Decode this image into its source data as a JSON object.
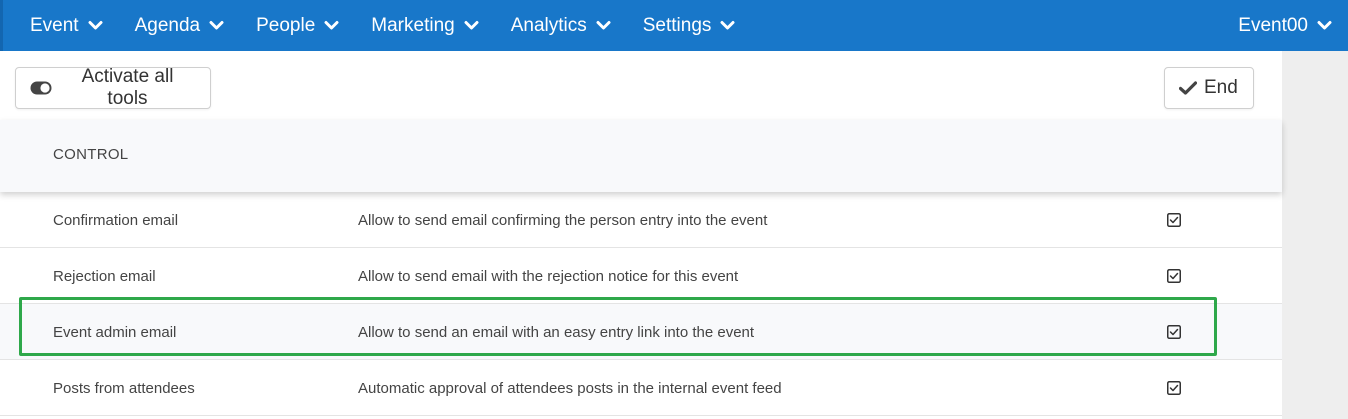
{
  "nav": {
    "items": [
      {
        "label": "Event"
      },
      {
        "label": "Agenda"
      },
      {
        "label": "People"
      },
      {
        "label": "Marketing"
      },
      {
        "label": "Analytics"
      },
      {
        "label": "Settings"
      }
    ],
    "account": "Event00"
  },
  "toolbar": {
    "activate_label": "Activate all tools",
    "end_label": "End"
  },
  "section": {
    "title": "CONTROL"
  },
  "rows": [
    {
      "name": "Confirmation email",
      "description": "Allow to send email confirming the person entry into the event",
      "checked": true
    },
    {
      "name": "Rejection email",
      "description": "Allow to send email with the rejection notice for this event",
      "checked": true
    },
    {
      "name": "Event admin email",
      "description": "Allow to send an email with an easy entry link into the event",
      "checked": true
    },
    {
      "name": "Posts from attendees",
      "description": "Automatic approval of attendees posts in the internal event feed",
      "checked": true
    }
  ],
  "colors": {
    "nav_bg": "#1877c9",
    "highlight": "#2ea84a",
    "gutter": "#eeeeee"
  }
}
